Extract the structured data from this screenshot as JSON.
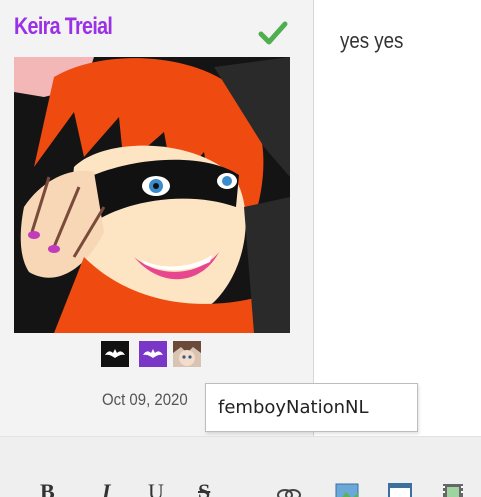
{
  "post": {
    "username": "Keira Treial",
    "date": "Oct 09, 2020",
    "message": "yes yes",
    "tooltip": "femboyNationNL"
  },
  "icons": {
    "status": "check-icon",
    "badges": [
      "bat-badge-icon",
      "bat-badge-purple-icon",
      "anime-avatar-badge-icon"
    ]
  },
  "toolbar": {
    "bold": "B",
    "italic": "I",
    "underline": "U",
    "strike": "S",
    "tools": [
      "link-icon",
      "image-icon",
      "window-icon",
      "video-icon"
    ]
  },
  "colors": {
    "username": "#9b30e6",
    "check": "#4fae4f",
    "panel_bg": "#f3f3f3"
  }
}
